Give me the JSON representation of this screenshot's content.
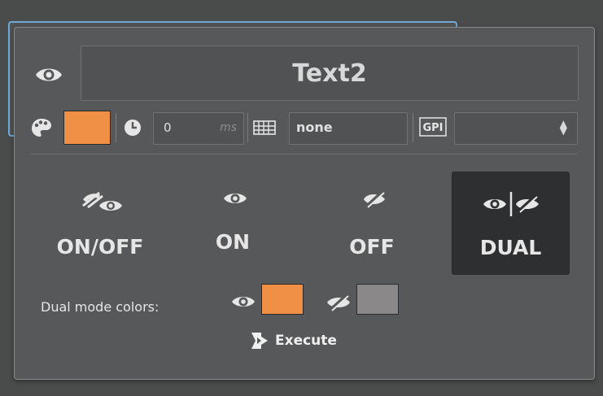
{
  "title": "Text2",
  "delay": {
    "value": "0",
    "unit": "ms"
  },
  "key": {
    "value": "none"
  },
  "gpi": {
    "icon_label": "GPI",
    "selected": ""
  },
  "modes": [
    {
      "label": "ON/OFF",
      "icon": "eye-slash-eye-icon",
      "selected": false
    },
    {
      "label": "ON",
      "icon": "eye-icon",
      "selected": false
    },
    {
      "label": "OFF",
      "icon": "eye-slash-icon",
      "selected": false
    },
    {
      "label": "DUAL",
      "icon": "eye-dual-icon",
      "selected": true
    }
  ],
  "dual_colors": {
    "label": "Dual mode colors:",
    "on_color": "#f09046",
    "off_color": "#8a8888"
  },
  "main_color": "#f09046",
  "execute": {
    "label": "Execute"
  }
}
